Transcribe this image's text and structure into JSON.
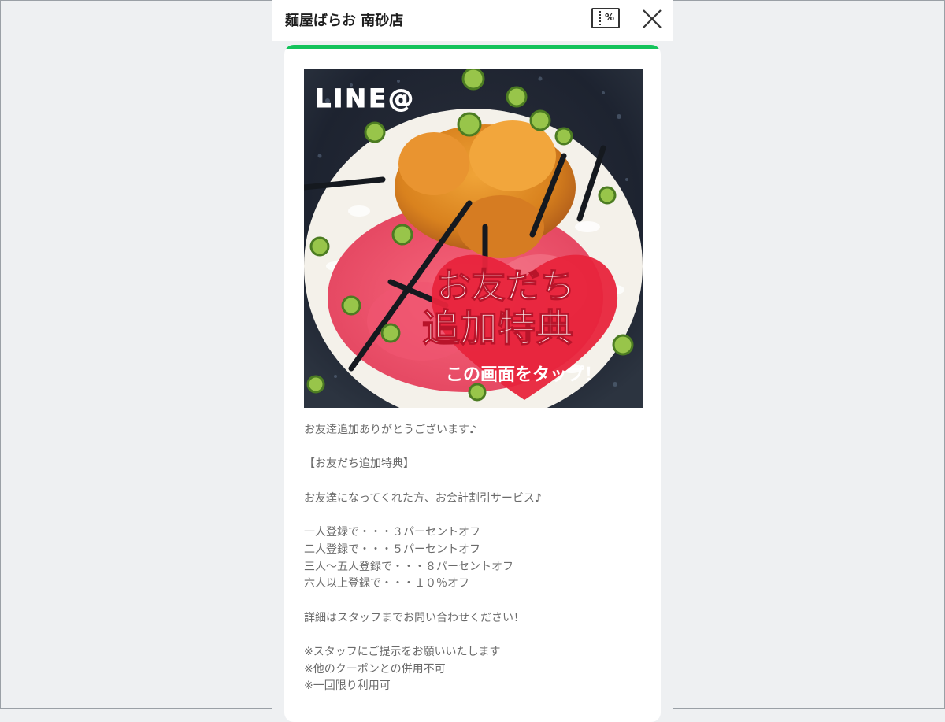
{
  "header": {
    "title": "麺屋ばらお 南砂店",
    "coupon_icon": "coupon-percent-icon",
    "coupon_icon_text": "%",
    "close_icon": "close-icon"
  },
  "colors": {
    "accent": "#13c35b",
    "background": "#eef0f2",
    "text_muted": "#6b6b6b",
    "heart": "#e8243c"
  },
  "coupon_image": {
    "logo_text": "LINE@",
    "headline_line1": "お友だち",
    "headline_line2": "追加特典",
    "cta": "この画面をタップ！"
  },
  "description": {
    "greeting": "お友達追加ありがとうございます♪",
    "section_title": "【お友だち追加特典】",
    "intro": "お友達になってくれた方、お会計割引サービス♪",
    "tiers": [
      "一人登録で・・・３パーセントオフ",
      "二人登録で・・・５パーセントオフ",
      "三人〜五人登録で・・・８パーセントオフ",
      "六人以上登録で・・・１０％オフ"
    ],
    "details": "詳細はスタッフまでお問い合わせください！",
    "notes": [
      "※スタッフにご提示をお願いいたします",
      "※他のクーポンとの併用不可",
      "※一回限り利用可"
    ]
  }
}
